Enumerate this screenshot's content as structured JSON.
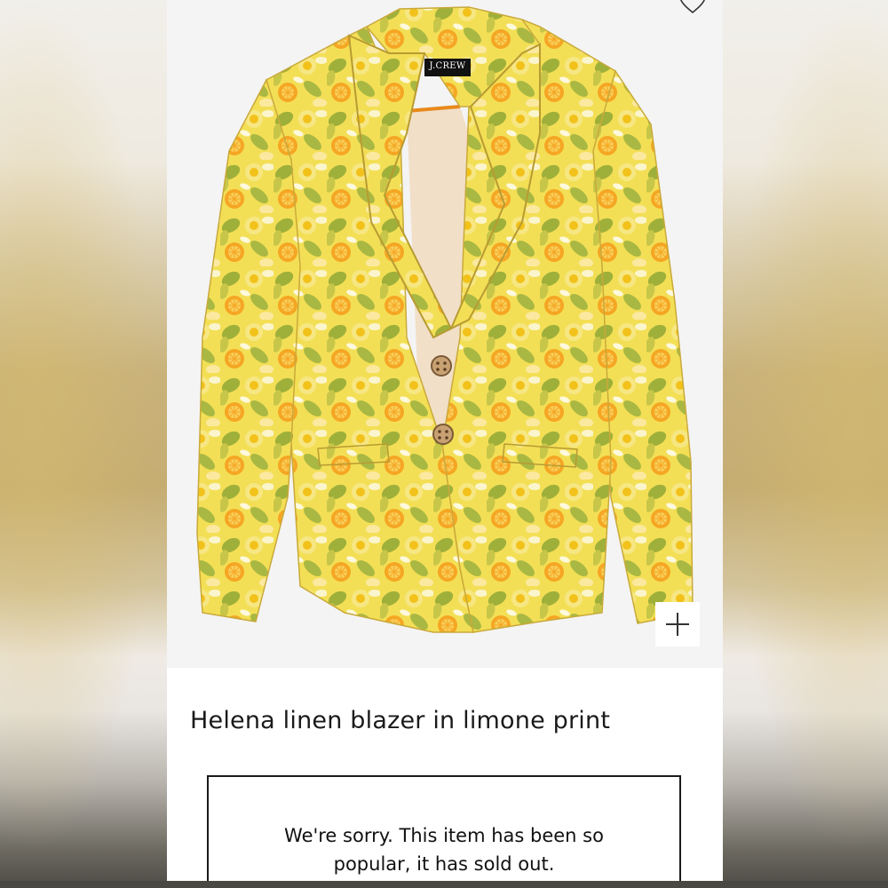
{
  "page": {
    "accent_color": "#f2c21b",
    "brand_color": "#1a1a1a"
  },
  "product": {
    "brand_label": "J.CREW",
    "title": "Helena linen blazer in limone print",
    "image_alt": "Helena linen blazer in limone print",
    "wishlist_icon": "heart-outline-icon",
    "zoom_icon": "plus-icon"
  },
  "availability": {
    "message": "We're sorry. This item has been so popular, it has sold out."
  }
}
